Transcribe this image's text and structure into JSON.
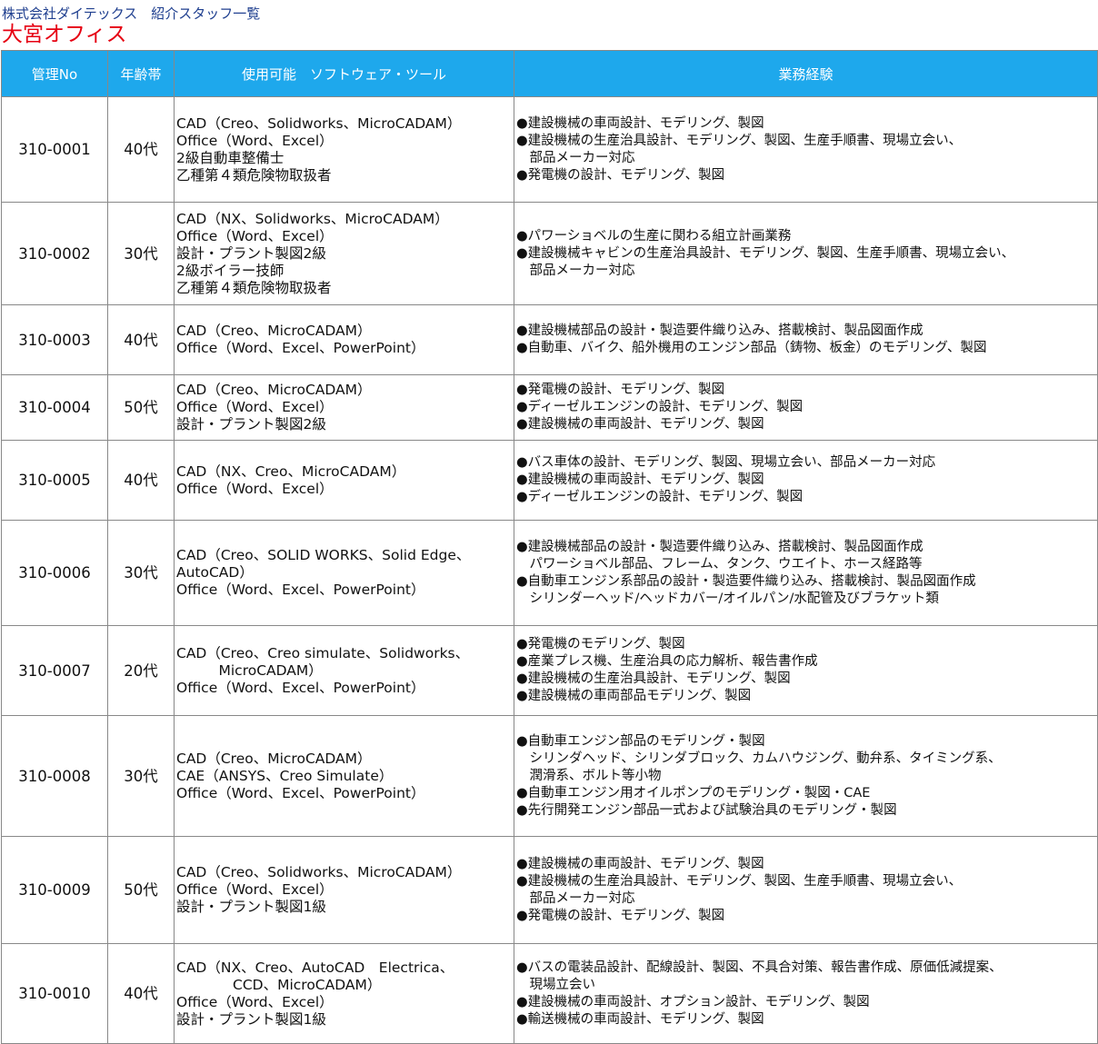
{
  "header": {
    "company_line": "株式会社ダイテックス　紹介スタッフ一覧",
    "office": "大宮オフィス"
  },
  "columns": [
    "管理No",
    "年齢帯",
    "使用可能　ソフトウェア・ツール",
    "業務経験"
  ],
  "colors": {
    "header_bg": "#1ea8ec",
    "header_text": "#ffffff",
    "office": "#e60012",
    "company": "#1f3f8f"
  },
  "rows": [
    {
      "id": "310-0001",
      "age": "40代",
      "skills": [
        "CAD（Creo、Solidworks、MicroCADAM）",
        "Office（Word、Excel）",
        "2級自動車整備士",
        "乙種第４類危険物取扱者"
      ],
      "experience": [
        "●建設機械の車両設計、モデリング、製図",
        "●建設機械の生産治具設計、モデリング、製図、生産手順書、現場立会い、",
        "　部品メーカー対応",
        "●発電機の設計、モデリング、製図"
      ]
    },
    {
      "id": "310-0002",
      "age": "30代",
      "skills": [
        "CAD（NX、Solidworks、MicroCADAM）",
        "Office（Word、Excel）",
        "設計・プラント製図2級",
        "2級ボイラー技師",
        "乙種第４類危険物取扱者"
      ],
      "experience": [
        "●パワーショベルの生産に関わる組立計画業務",
        "●建設機械キャビンの生産治具設計、モデリング、製図、生産手順書、現場立会い、",
        "　部品メーカー対応"
      ]
    },
    {
      "id": "310-0003",
      "age": "40代",
      "skills": [
        "CAD（Creo、MicroCADAM）",
        "Office（Word、Excel、PowerPoint）"
      ],
      "experience": [
        "●建設機械部品の設計・製造要件織り込み、搭載検討、製品図面作成",
        "●自動車、バイク、船外機用のエンジン部品（鋳物、板金）のモデリング、製図"
      ]
    },
    {
      "id": "310-0004",
      "age": "50代",
      "skills": [
        "CAD（Creo、MicroCADAM）",
        "Office（Word、Excel）",
        "設計・プラント製図2級"
      ],
      "experience": [
        "●発電機の設計、モデリング、製図",
        "●ディーゼルエンジンの設計、モデリング、製図",
        "●建設機械の車両設計、モデリング、製図"
      ]
    },
    {
      "id": "310-0005",
      "age": "40代",
      "skills": [
        "CAD（NX、Creo、MicroCADAM）",
        "Office（Word、Excel）"
      ],
      "experience": [
        "●バス車体の設計、モデリング、製図、現場立会い、部品メーカー対応",
        "●建設機械の車両設計、モデリング、製図",
        "●ディーゼルエンジンの設計、モデリング、製図"
      ]
    },
    {
      "id": "310-0006",
      "age": "30代",
      "skills": [
        "CAD（Creo、SOLID WORKS、Solid Edge、",
        "AutoCAD）",
        "Office（Word、Excel、PowerPoint）"
      ],
      "experience": [
        "●建設機械部品の設計・製造要件織り込み、搭載検討、製品図面作成",
        "　パワーショベル部品、フレーム、タンク、ウエイト、ホース経路等",
        "●自動車エンジン系部品の設計・製造要件織り込み、搭載検討、製品図面作成",
        "　シリンダーヘッド/ヘッドカバー/オイルパン/水配管及びブラケット類"
      ]
    },
    {
      "id": "310-0007",
      "age": "20代",
      "skills": [
        "CAD（Creo、Creo simulate、Solidworks、",
        "　　　MicroCADAM）",
        "Office（Word、Excel、PowerPoint）"
      ],
      "experience": [
        "●発電機のモデリング、製図",
        "●産業プレス機、生産治具の応力解析、報告書作成",
        "●建設機械の生産治具設計、モデリング、製図",
        "●建設機械の車両部品モデリング、製図"
      ]
    },
    {
      "id": "310-0008",
      "age": "30代",
      "skills": [
        "CAD（Creo、MicroCADAM）",
        "CAE（ANSYS、Creo Simulate）",
        "Office（Word、Excel、PowerPoint）"
      ],
      "experience": [
        "●自動車エンジン部品のモデリング・製図",
        "　シリンダヘッド、シリンダブロック、カムハウジング、動弁系、タイミング系、",
        "　潤滑系、ボルト等小物",
        "●自動車エンジン用オイルポンプのモデリング・製図・CAE",
        "●先行開発エンジン部品一式および試験治具のモデリング・製図"
      ]
    },
    {
      "id": "310-0009",
      "age": "50代",
      "skills": [
        "CAD（Creo、Solidworks、MicroCADAM）",
        "Office（Word、Excel）",
        "設計・プラント製図1級"
      ],
      "experience": [
        "●建設機械の車両設計、モデリング、製図",
        "●建設機械の生産治具設計、モデリング、製図、生産手順書、現場立会い、",
        "　部品メーカー対応",
        "●発電機の設計、モデリング、製図"
      ]
    },
    {
      "id": "310-0010",
      "age": "40代",
      "skills": [
        "CAD（NX、Creo、AutoCAD　Electrica、",
        "　　　　CCD、MicroCADAM）",
        "Office（Word、Excel）",
        "設計・プラント製図1級"
      ],
      "experience": [
        "●バスの電装品設計、配線設計、製図、不具合対策、報告書作成、原価低減提案、",
        "　現場立会い",
        "●建設機械の車両設計、オプション設計、モデリング、製図",
        "●輸送機械の車両設計、モデリング、製図"
      ]
    }
  ]
}
